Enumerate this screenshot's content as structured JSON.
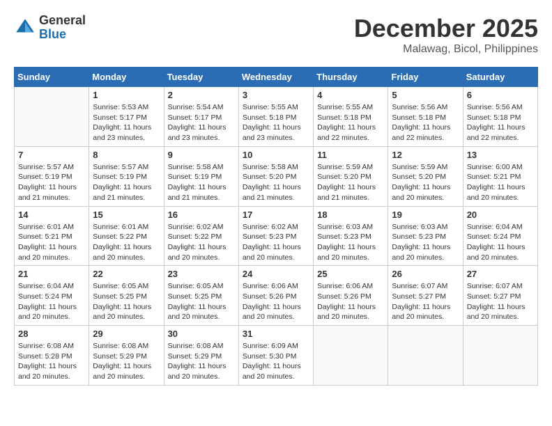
{
  "header": {
    "logo": {
      "general": "General",
      "blue": "Blue"
    },
    "title": "December 2025",
    "location": "Malawag, Bicol, Philippines"
  },
  "calendar": {
    "days_of_week": [
      "Sunday",
      "Monday",
      "Tuesday",
      "Wednesday",
      "Thursday",
      "Friday",
      "Saturday"
    ],
    "weeks": [
      [
        {
          "day": "",
          "info": ""
        },
        {
          "day": "1",
          "info": "Sunrise: 5:53 AM\nSunset: 5:17 PM\nDaylight: 11 hours\nand 23 minutes."
        },
        {
          "day": "2",
          "info": "Sunrise: 5:54 AM\nSunset: 5:17 PM\nDaylight: 11 hours\nand 23 minutes."
        },
        {
          "day": "3",
          "info": "Sunrise: 5:55 AM\nSunset: 5:18 PM\nDaylight: 11 hours\nand 23 minutes."
        },
        {
          "day": "4",
          "info": "Sunrise: 5:55 AM\nSunset: 5:18 PM\nDaylight: 11 hours\nand 22 minutes."
        },
        {
          "day": "5",
          "info": "Sunrise: 5:56 AM\nSunset: 5:18 PM\nDaylight: 11 hours\nand 22 minutes."
        },
        {
          "day": "6",
          "info": "Sunrise: 5:56 AM\nSunset: 5:18 PM\nDaylight: 11 hours\nand 22 minutes."
        }
      ],
      [
        {
          "day": "7",
          "info": "Sunrise: 5:57 AM\nSunset: 5:19 PM\nDaylight: 11 hours\nand 21 minutes."
        },
        {
          "day": "8",
          "info": "Sunrise: 5:57 AM\nSunset: 5:19 PM\nDaylight: 11 hours\nand 21 minutes."
        },
        {
          "day": "9",
          "info": "Sunrise: 5:58 AM\nSunset: 5:19 PM\nDaylight: 11 hours\nand 21 minutes."
        },
        {
          "day": "10",
          "info": "Sunrise: 5:58 AM\nSunset: 5:20 PM\nDaylight: 11 hours\nand 21 minutes."
        },
        {
          "day": "11",
          "info": "Sunrise: 5:59 AM\nSunset: 5:20 PM\nDaylight: 11 hours\nand 21 minutes."
        },
        {
          "day": "12",
          "info": "Sunrise: 5:59 AM\nSunset: 5:20 PM\nDaylight: 11 hours\nand 20 minutes."
        },
        {
          "day": "13",
          "info": "Sunrise: 6:00 AM\nSunset: 5:21 PM\nDaylight: 11 hours\nand 20 minutes."
        }
      ],
      [
        {
          "day": "14",
          "info": "Sunrise: 6:01 AM\nSunset: 5:21 PM\nDaylight: 11 hours\nand 20 minutes."
        },
        {
          "day": "15",
          "info": "Sunrise: 6:01 AM\nSunset: 5:22 PM\nDaylight: 11 hours\nand 20 minutes."
        },
        {
          "day": "16",
          "info": "Sunrise: 6:02 AM\nSunset: 5:22 PM\nDaylight: 11 hours\nand 20 minutes."
        },
        {
          "day": "17",
          "info": "Sunrise: 6:02 AM\nSunset: 5:23 PM\nDaylight: 11 hours\nand 20 minutes."
        },
        {
          "day": "18",
          "info": "Sunrise: 6:03 AM\nSunset: 5:23 PM\nDaylight: 11 hours\nand 20 minutes."
        },
        {
          "day": "19",
          "info": "Sunrise: 6:03 AM\nSunset: 5:23 PM\nDaylight: 11 hours\nand 20 minutes."
        },
        {
          "day": "20",
          "info": "Sunrise: 6:04 AM\nSunset: 5:24 PM\nDaylight: 11 hours\nand 20 minutes."
        }
      ],
      [
        {
          "day": "21",
          "info": "Sunrise: 6:04 AM\nSunset: 5:24 PM\nDaylight: 11 hours\nand 20 minutes."
        },
        {
          "day": "22",
          "info": "Sunrise: 6:05 AM\nSunset: 5:25 PM\nDaylight: 11 hours\nand 20 minutes."
        },
        {
          "day": "23",
          "info": "Sunrise: 6:05 AM\nSunset: 5:25 PM\nDaylight: 11 hours\nand 20 minutes."
        },
        {
          "day": "24",
          "info": "Sunrise: 6:06 AM\nSunset: 5:26 PM\nDaylight: 11 hours\nand 20 minutes."
        },
        {
          "day": "25",
          "info": "Sunrise: 6:06 AM\nSunset: 5:26 PM\nDaylight: 11 hours\nand 20 minutes."
        },
        {
          "day": "26",
          "info": "Sunrise: 6:07 AM\nSunset: 5:27 PM\nDaylight: 11 hours\nand 20 minutes."
        },
        {
          "day": "27",
          "info": "Sunrise: 6:07 AM\nSunset: 5:27 PM\nDaylight: 11 hours\nand 20 minutes."
        }
      ],
      [
        {
          "day": "28",
          "info": "Sunrise: 6:08 AM\nSunset: 5:28 PM\nDaylight: 11 hours\nand 20 minutes."
        },
        {
          "day": "29",
          "info": "Sunrise: 6:08 AM\nSunset: 5:29 PM\nDaylight: 11 hours\nand 20 minutes."
        },
        {
          "day": "30",
          "info": "Sunrise: 6:08 AM\nSunset: 5:29 PM\nDaylight: 11 hours\nand 20 minutes."
        },
        {
          "day": "31",
          "info": "Sunrise: 6:09 AM\nSunset: 5:30 PM\nDaylight: 11 hours\nand 20 minutes."
        },
        {
          "day": "",
          "info": ""
        },
        {
          "day": "",
          "info": ""
        },
        {
          "day": "",
          "info": ""
        }
      ]
    ]
  }
}
